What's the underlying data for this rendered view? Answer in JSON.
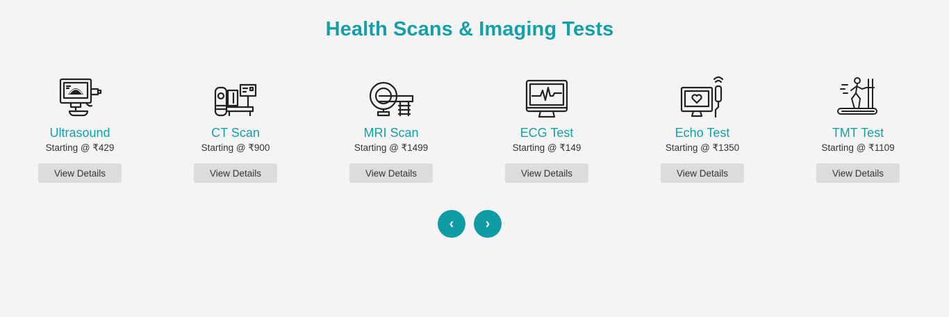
{
  "section": {
    "title": "Health Scans & Imaging Tests"
  },
  "colors": {
    "accent": "#14a0a8",
    "nav_button": "#0e9ba4",
    "button_bg": "#dcdcdc",
    "background": "#f4f4f4"
  },
  "cards": [
    {
      "name": "Ultrasound",
      "price": "Starting @ ₹429",
      "button": "View Details",
      "icon": "ultrasound-machine-icon"
    },
    {
      "name": "CT Scan",
      "price": "Starting @ ₹900",
      "button": "View Details",
      "icon": "ct-scanner-icon"
    },
    {
      "name": "MRI Scan",
      "price": "Starting @ ₹1499",
      "button": "View Details",
      "icon": "mri-scanner-icon"
    },
    {
      "name": "ECG Test",
      "price": "Starting @ ₹149",
      "button": "View Details",
      "icon": "ecg-monitor-icon"
    },
    {
      "name": "Echo Test",
      "price": "Starting @ ₹1350",
      "button": "View Details",
      "icon": "echo-heart-monitor-icon"
    },
    {
      "name": "TMT Test",
      "price": "Starting @ ₹1109",
      "button": "View Details",
      "icon": "treadmill-test-icon"
    }
  ],
  "carousel": {
    "prev_label": "‹",
    "next_label": "›"
  }
}
